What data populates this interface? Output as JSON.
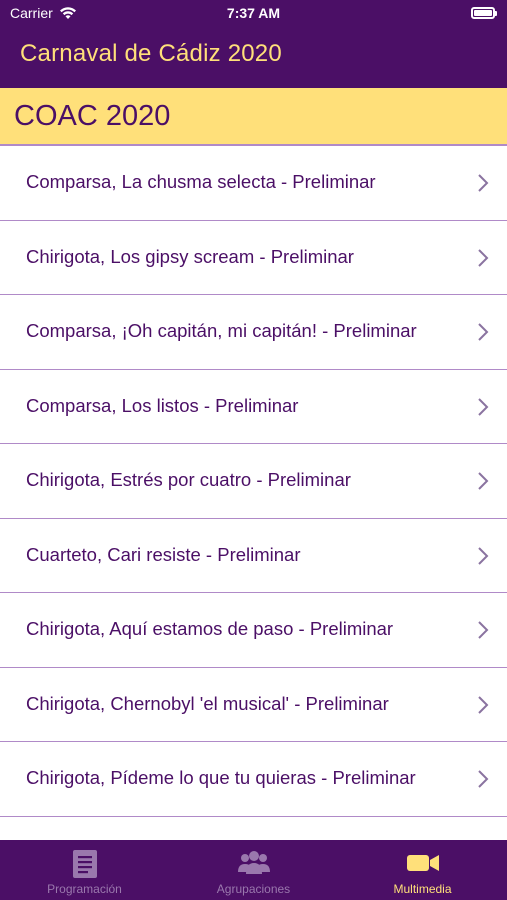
{
  "status": {
    "carrier": "Carrier",
    "time": "7:37 AM"
  },
  "nav": {
    "title": "Carnaval de Cádiz 2020"
  },
  "section": {
    "title": "COAC 2020"
  },
  "items": [
    {
      "label": "Comparsa, La chusma selecta - Preliminar"
    },
    {
      "label": "Chirigota, Los gipsy scream - Preliminar"
    },
    {
      "label": "Comparsa, ¡Oh capitán, mi capitán! - Preliminar"
    },
    {
      "label": "Comparsa, Los listos - Preliminar"
    },
    {
      "label": "Chirigota, Estrés por cuatro - Preliminar"
    },
    {
      "label": "Cuarteto, Cari resiste - Preliminar"
    },
    {
      "label": "Chirigota, Aquí estamos de paso - Preliminar"
    },
    {
      "label": "Chirigota, Chernobyl 'el musical' - Preliminar"
    },
    {
      "label": "Chirigota, Pídeme lo que tu quieras - Preliminar"
    }
  ],
  "tabs": [
    {
      "label": "Programación",
      "icon": "document-icon",
      "active": false
    },
    {
      "label": "Agrupaciones",
      "icon": "group-icon",
      "active": false
    },
    {
      "label": "Multimedia",
      "icon": "video-camera-icon",
      "active": true
    }
  ],
  "colors": {
    "brand_purple": "#4b0f66",
    "accent_yellow": "#ffe07a",
    "separator": "#b08ac8",
    "inactive_tab": "#9a78ad"
  }
}
